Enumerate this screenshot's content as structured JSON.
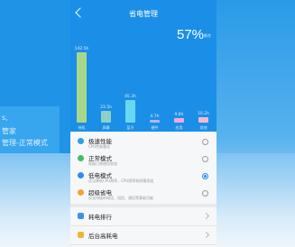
{
  "background": {
    "left_panel_lines": [
      "s,",
      "管家",
      "管理-正常模式"
    ]
  },
  "header": {
    "title": "省电管理"
  },
  "battery": {
    "percent_label": "57%",
    "percent_sub": "剩余"
  },
  "chart_data": {
    "type": "bar",
    "categories": [
      "待机",
      "屏幕",
      "蓝牙",
      "硬件",
      "应用",
      "其他"
    ],
    "values": [
      142.5,
      23.5,
      45.3,
      4.7,
      9.8,
      10.2
    ],
    "labels": [
      "142.5h",
      "23.5h",
      "45.3h",
      "4.7h",
      "9.8h",
      "10.2h"
    ],
    "colors": [
      "#a7d88a",
      "#8fd0c4",
      "#69d7f0",
      "#b9b3f5",
      "#f2a9d8",
      "#f6b9c9"
    ],
    "ylim": [
      0,
      150
    ]
  },
  "modes": [
    {
      "title": "极速性能",
      "desc": "CPU性能最佳",
      "color": "#2f9ee9",
      "selected": false
    },
    {
      "title": "正常模式",
      "desc": "保留日常使用状态",
      "color": "#3ec066",
      "selected": false
    },
    {
      "title": "低电模式",
      "desc": "适当降低CPU频率，CPU频率和屏幕亮度",
      "color": "#2f8fe6",
      "selected": true
    },
    {
      "title": "超级省电",
      "desc": "仅支持接听电话、短信、通话等基础功能",
      "color": "#f2a337",
      "selected": false
    }
  ],
  "list": [
    {
      "label": "耗电排行",
      "color": "#3f90e6"
    },
    {
      "label": "后台高耗电",
      "color": "#f0b43c"
    }
  ]
}
